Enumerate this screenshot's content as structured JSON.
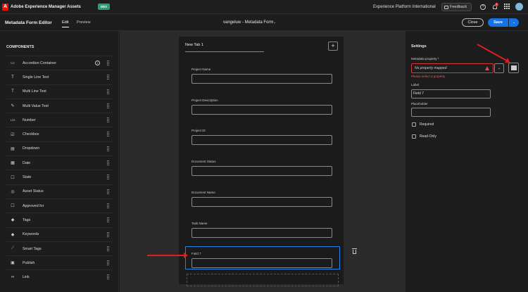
{
  "topbar": {
    "logo_letter": "A",
    "app_title": "Adobe Experience Manager Assets",
    "env_badge": "DEV",
    "org_name": "Experience Platform International",
    "feedback_label": "Feedback",
    "help_glyph": "?",
    "notification_count": "4"
  },
  "editor": {
    "title": "Metadata Form Editor",
    "tab_edit": "Edit",
    "tab_preview": "Preview",
    "form_name": "vangeluw - Metadata Form",
    "form_chevron": "⌄",
    "close_label": "Close",
    "save_label": "Save",
    "save_menu_glyph": "⌄"
  },
  "components": {
    "heading": "COMPONENTS",
    "items": [
      {
        "label": "Accordion Container",
        "icon": "accordion-icon",
        "glyph": "▭"
      },
      {
        "label": "Single Line Text",
        "icon": "text-icon",
        "glyph": "T"
      },
      {
        "label": "Multi Line Text",
        "icon": "text-icon",
        "glyph": "T"
      },
      {
        "label": "Multi Value Text",
        "icon": "tag-edit-icon",
        "glyph": "✎"
      },
      {
        "label": "Number",
        "icon": "number-icon",
        "glyph": "123"
      },
      {
        "label": "Checkbox",
        "icon": "checkbox-icon",
        "glyph": "☑"
      },
      {
        "label": "Dropdown",
        "icon": "dropdown-icon",
        "glyph": "▤"
      },
      {
        "label": "Date",
        "icon": "calendar-icon",
        "glyph": "▦"
      },
      {
        "label": "State",
        "icon": "state-icon",
        "glyph": "☐"
      },
      {
        "label": "Asset Status",
        "icon": "status-icon",
        "glyph": "◎"
      },
      {
        "label": "Approved for",
        "icon": "approved-icon",
        "glyph": "☐"
      },
      {
        "label": "Tags",
        "icon": "tag-icon",
        "glyph": "◆"
      },
      {
        "label": "Keywords",
        "icon": "keyword-icon",
        "glyph": "◆"
      },
      {
        "label": "Smart Tags",
        "icon": "wand-icon",
        "glyph": "⟋"
      },
      {
        "label": "Publish",
        "icon": "publish-icon",
        "glyph": "▣"
      },
      {
        "label": "Link",
        "icon": "link-icon",
        "glyph": "∞"
      }
    ]
  },
  "canvas": {
    "tab_label": "New Tab 1",
    "add_tab_glyph": "+",
    "fields": [
      {
        "label": "Project Name"
      },
      {
        "label": "Project Description"
      },
      {
        "label": "Project ID"
      },
      {
        "label": "Document Status"
      },
      {
        "label": "Document Name"
      },
      {
        "label": "Task Name"
      },
      {
        "label": "Field 7"
      }
    ]
  },
  "settings": {
    "heading": "Settings",
    "property_label": "Metadata property",
    "required_marker": "*",
    "property_value": "No property mapped",
    "property_chevron": "⌄",
    "property_error": "Please select a property",
    "label_label": "Label",
    "label_value": "Field 7",
    "placeholder_label": "Placeholder",
    "placeholder_value": "",
    "required_option": "Required",
    "readonly_option": "Read-Only"
  },
  "colors": {
    "accent": "#1473e6",
    "error": "#e34850",
    "annotation_arrow": "#e21d1d",
    "selected_border": "#2680eb"
  }
}
